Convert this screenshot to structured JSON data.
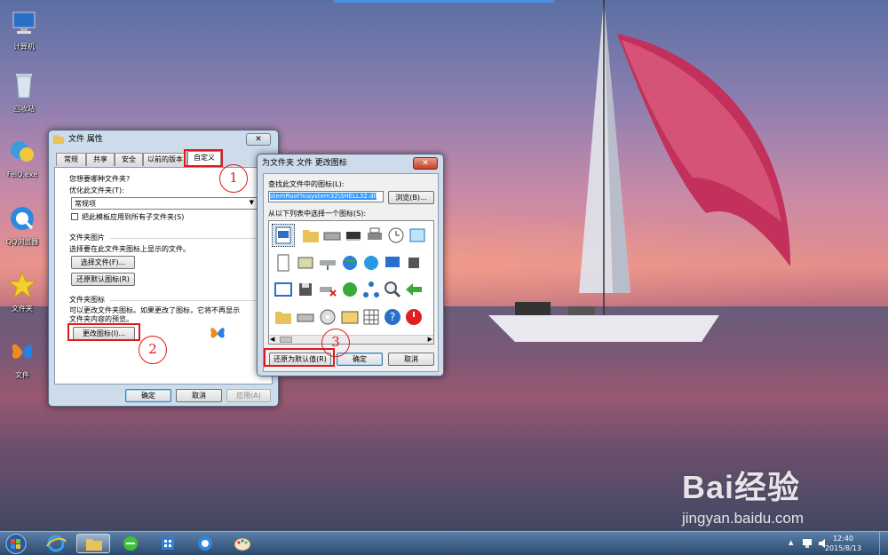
{
  "desktop": {
    "icons": [
      {
        "label": "计算机",
        "icon": "computer-icon"
      },
      {
        "label": "回收站",
        "icon": "recycle-bin-icon"
      },
      {
        "label": "FeiQ.exe",
        "icon": "feiq-icon"
      },
      {
        "label": "QQ浏览器",
        "icon": "qq-browser-icon"
      },
      {
        "label": "文件夹",
        "icon": "star-folder-icon"
      },
      {
        "label": "文件",
        "icon": "butterfly-icon"
      }
    ]
  },
  "props_dialog": {
    "title": "文件 属性",
    "close": "✕",
    "tabs": [
      "常规",
      "共享",
      "安全",
      "以前的版本",
      "自定义"
    ],
    "active_tab": "自定义",
    "q_label": "您想要哪种文件夹?",
    "optimize_label": "优化此文件夹(T):",
    "optimize_value": "常规项",
    "apply_sub_label": "把此模板应用到所有子文件夹(S)",
    "apply_sub_checked": false,
    "pictures_group": "文件夹图片",
    "pictures_desc": "选择要在此文件夹图标上显示的文件。",
    "choose_file_btn": "选择文件(F)...",
    "restore_default_btn": "还原默认图标(R)",
    "icons_group": "文件夹图标",
    "icons_desc_1": "可以更改文件夹图标。如果更改了图标，它将不再显示",
    "icons_desc_2": "文件夹内容的预览。",
    "change_icon_btn": "更改图标(I)...",
    "ok": "确定",
    "cancel": "取消",
    "apply": "应用(A)"
  },
  "change_icon_dialog": {
    "title": "为文件夹 文件 更改图标",
    "close": "✕",
    "find_label": "查找此文件中的图标(L):",
    "path_value": "stemRoot%\\system32\\SHELL32.dll",
    "browse_btn": "浏览(B)...",
    "select_label": "从以下列表中选择一个图标(S):",
    "restore_btn": "还原为默认值(R)",
    "ok": "确定",
    "cancel": "取消"
  },
  "annotations": {
    "step1": "1",
    "step2": "2",
    "step3": "3",
    "color": "#e0191d"
  },
  "taskbar": {
    "time": "12:40",
    "date": "2015/8/13",
    "tray_arrow": "▲"
  },
  "watermark": {
    "brand": "Bai经验",
    "url": "jingyan.baidu.com"
  }
}
